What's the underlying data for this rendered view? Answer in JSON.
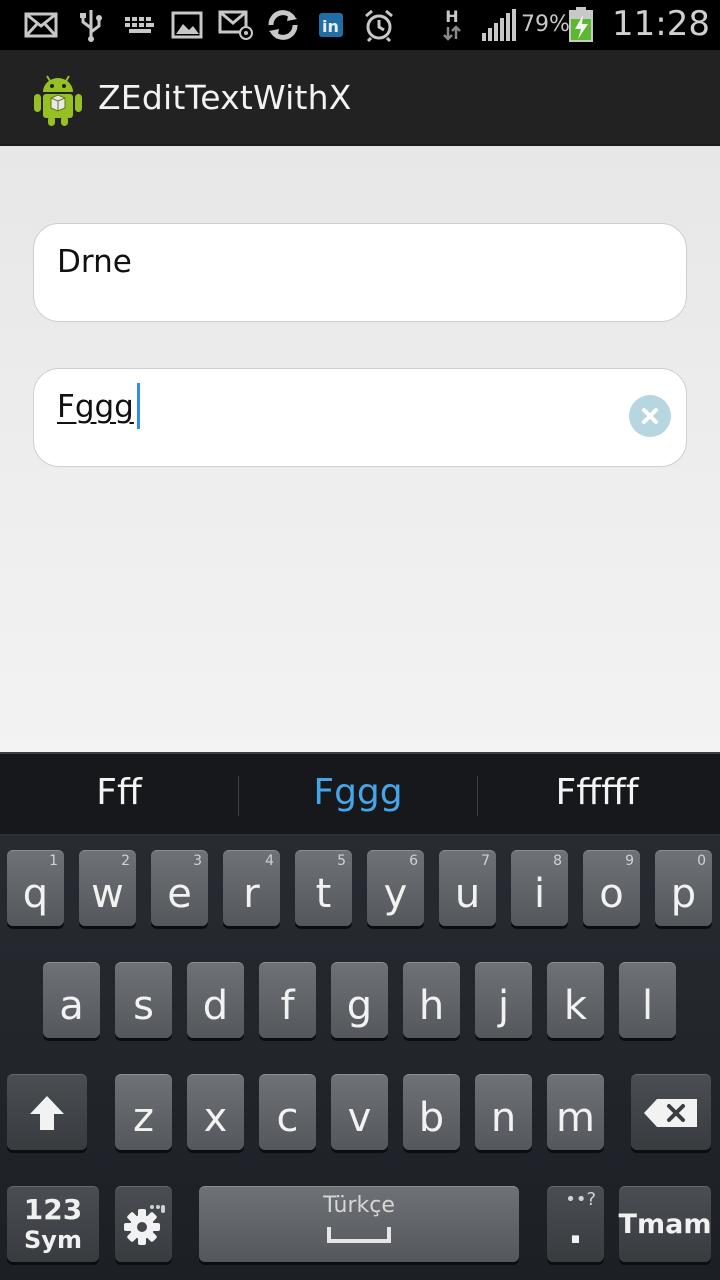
{
  "status_bar": {
    "icons": [
      "email-icon",
      "usb-icon",
      "keyboard-icon",
      "gallery-icon",
      "mail-at-icon",
      "sync-icon",
      "linkedin-icon",
      "alarm-icon",
      "hspa-data-icon",
      "signal-icon",
      "battery-charging-icon"
    ],
    "network_label": "H",
    "battery": "79%",
    "time": "11:28"
  },
  "action_bar": {
    "title": "ZEditTextWithX",
    "icon": "android-app-icon"
  },
  "fields": [
    {
      "value": "Drne"
    },
    {
      "value": "Fggg",
      "clear_icon": "clear-x-icon"
    }
  ],
  "suggestions": [
    "Fff",
    "Fggg",
    "Ffffff"
  ],
  "keyboard": {
    "row1": [
      {
        "key": "q",
        "num": "1"
      },
      {
        "key": "w",
        "num": "2"
      },
      {
        "key": "e",
        "num": "3"
      },
      {
        "key": "r",
        "num": "4"
      },
      {
        "key": "t",
        "num": "5"
      },
      {
        "key": "y",
        "num": "6"
      },
      {
        "key": "u",
        "num": "7"
      },
      {
        "key": "i",
        "num": "8"
      },
      {
        "key": "o",
        "num": "9"
      },
      {
        "key": "p",
        "num": "0"
      }
    ],
    "row2": [
      "a",
      "s",
      "d",
      "f",
      "g",
      "h",
      "j",
      "k",
      "l"
    ],
    "row3": [
      "z",
      "x",
      "c",
      "v",
      "b",
      "n",
      "m"
    ],
    "sym_top": "123",
    "sym_bottom": "Sym",
    "space_label": "Türkçe",
    "punct_key": ".",
    "punct_hint": "••?",
    "done_label": "Tmam",
    "accent_color": "#44a6e8"
  }
}
